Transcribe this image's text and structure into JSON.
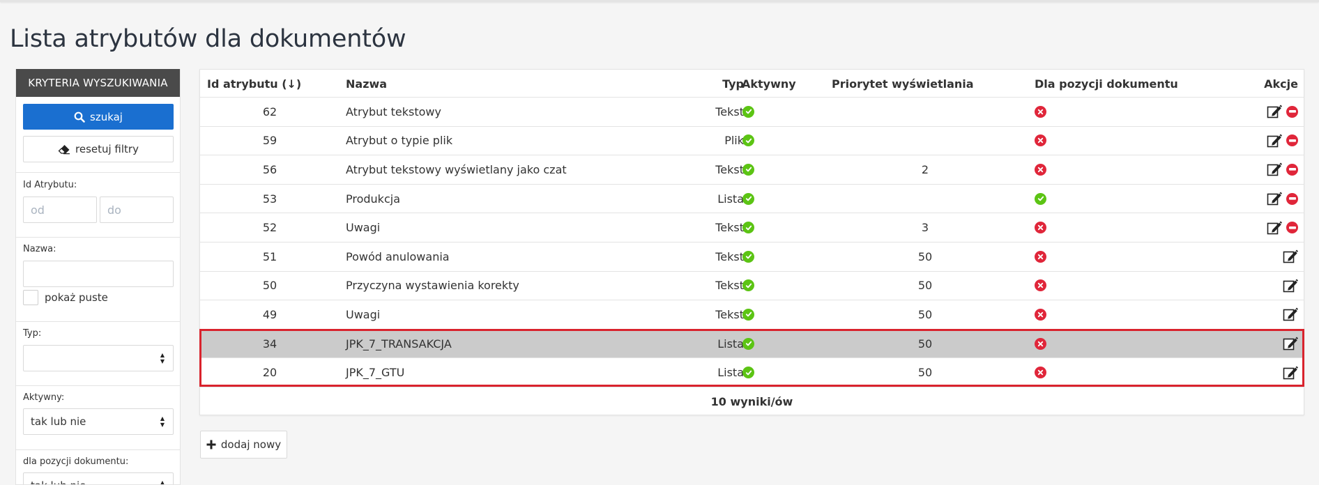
{
  "page": {
    "title": "Lista atrybutów dla dokumentów"
  },
  "sidebar": {
    "header": "KRYTERIA WYSZUKIWANIA",
    "search_label": "szukaj",
    "reset_label": "resetuj filtry",
    "id_label": "Id Atrybutu:",
    "id_from_placeholder": "od",
    "id_to_placeholder": "do",
    "name_label": "Nazwa:",
    "name_value": "",
    "show_empty_label": "pokaż puste",
    "type_label": "Typ:",
    "type_value": "",
    "active_label": "Aktywny:",
    "active_value": "tak lub nie",
    "position_label": "dla pozycji dokumentu:",
    "position_value": "tak lub nie"
  },
  "table": {
    "columns": {
      "id": "Id atrybutu (↓)",
      "name": "Nazwa",
      "type": "Typ",
      "active": "Aktywny",
      "priority": "Priorytet wyświetlania",
      "for_position": "Dla pozycji dokumentu",
      "actions": "Akcje"
    },
    "rows": [
      {
        "id": "62",
        "name": "Atrybut tekstowy",
        "type": "Tekst",
        "active": true,
        "priority": "",
        "for_position": false,
        "deletable": true
      },
      {
        "id": "59",
        "name": "Atrybut o typie plik",
        "type": "Plik",
        "active": true,
        "priority": "",
        "for_position": false,
        "deletable": true
      },
      {
        "id": "56",
        "name": "Atrybut tekstowy wyświetlany jako czat",
        "type": "Tekst",
        "active": true,
        "priority": "2",
        "for_position": false,
        "deletable": true
      },
      {
        "id": "53",
        "name": "Produkcja",
        "type": "Lista",
        "active": true,
        "priority": "",
        "for_position": true,
        "deletable": true
      },
      {
        "id": "52",
        "name": "Uwagi",
        "type": "Tekst",
        "active": true,
        "priority": "3",
        "for_position": false,
        "deletable": true
      },
      {
        "id": "51",
        "name": "Powód anulowania",
        "type": "Tekst",
        "active": true,
        "priority": "50",
        "for_position": false,
        "deletable": false
      },
      {
        "id": "50",
        "name": "Przyczyna wystawienia korekty",
        "type": "Tekst",
        "active": true,
        "priority": "50",
        "for_position": false,
        "deletable": false
      },
      {
        "id": "49",
        "name": "Uwagi",
        "type": "Tekst",
        "active": true,
        "priority": "50",
        "for_position": false,
        "deletable": false
      },
      {
        "id": "34",
        "name": "JPK_7_TRANSAKCJA",
        "type": "Lista",
        "active": true,
        "priority": "50",
        "for_position": false,
        "deletable": false,
        "selected": true
      },
      {
        "id": "20",
        "name": "JPK_7_GTU",
        "type": "Lista",
        "active": true,
        "priority": "50",
        "for_position": false,
        "deletable": false
      }
    ],
    "footer": "10 wyniki/ów"
  },
  "add_button_label": "dodaj nowy",
  "colors": {
    "primary": "#1a6fd0",
    "sidebar_header": "#4a4a4a",
    "ok": "#5cc414",
    "error": "#e0263a",
    "highlight": "#d9232d",
    "selected_row": "#cbcbcb"
  }
}
